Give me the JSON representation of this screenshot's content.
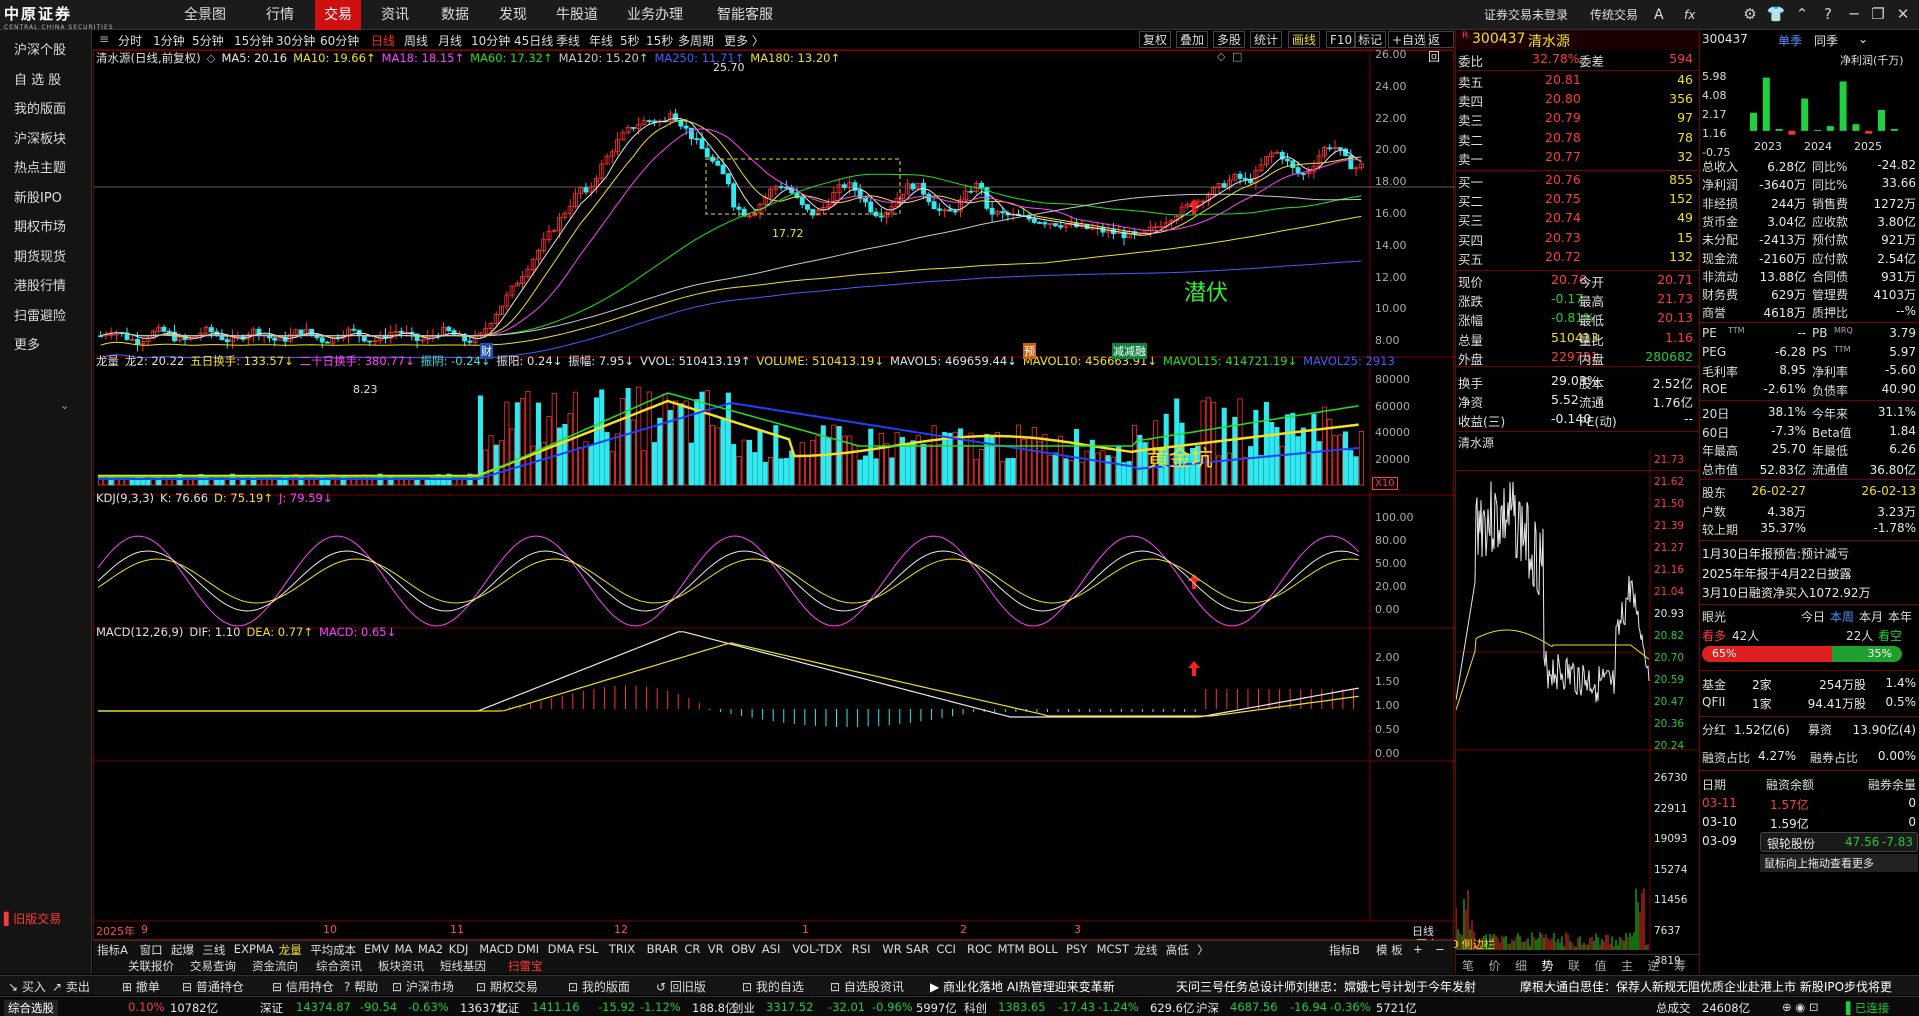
{
  "logo": {
    "text": "中原证券",
    "subtext": "CENTRAL CHINA SECURITIES"
  },
  "topnav": [
    "全景图",
    "行情",
    "交易",
    "资讯",
    "数据",
    "发现",
    "牛股道",
    "业务办理",
    "智能客服"
  ],
  "topright": {
    "login": "证券交易未登录",
    "mode": "传统交易",
    "font_icon": "A",
    "fx": "fx"
  },
  "sidebar": [
    "沪深个股",
    "自 选 股",
    "我的版面",
    "沪深板块",
    "热点主题",
    "新股IPO",
    "期权市场",
    "期货现货",
    "港股行情",
    "扫雷避险",
    "更多"
  ],
  "sidebar_bottom": "旧版交易",
  "toolbar_periods": [
    "分时",
    "1分钟",
    "5分钟",
    "15分钟",
    "30分钟",
    "60分钟",
    "日线",
    "周线",
    "月线",
    "10分钟",
    "45日线",
    "季线",
    "年线",
    "5秒",
    "15秒",
    "多周期",
    "更多"
  ],
  "toolbar_right": [
    "复权",
    "叠加",
    "多股",
    "统计",
    "画线",
    "F10",
    "标记",
    "+自选",
    "返回"
  ],
  "main_legend": {
    "name": "清水源(日线,前复权)",
    "ma5": "MA5: 20.16",
    "ma10": "MA10: 19.66",
    "ma18": "MA18: 18.15",
    "ma60": "MA60: 17.32",
    "ma120": "MA120: 15.20",
    "ma250": "MA250: 11.71",
    "ma180": "MA180: 13.20"
  },
  "price_axis": [
    "26.00",
    "24.00",
    "22.00",
    "20.00",
    "18.00",
    "16.00",
    "14.00",
    "12.00",
    "10.00",
    "8.00"
  ],
  "price_marks": {
    "high": "25.70",
    "low": "8.23",
    "box": "17.72"
  },
  "annotations": {
    "qianfu": "潜伏",
    "huangjinkeng": "黄金坑"
  },
  "event_markers": [
    "财",
    "预",
    "减减融"
  ],
  "vol_legend": {
    "name": "龙量",
    "l2": "龙2: 20.22",
    "wr5": "五日换手: 133.57",
    "wr20": "二十日换手: 380.77",
    "zy": "振阴: -0.24",
    "zyang": "振阳: 0.24",
    "zf": "振幅: 7.95",
    "vvol": "VVOL: 510413.19",
    "volume": "VOLUME: 510413.19",
    "mavol5": "MAVOL5: 469659.44",
    "mavol10": "MAVOL10: 456663.91",
    "mavol15": "MAVOL15: 414721.19",
    "mavol25": "MAVOL25: 2913"
  },
  "vol_axis": [
    "80000",
    "60000",
    "40000",
    "20000"
  ],
  "vol_unit": "X10",
  "kdj_legend": {
    "name": "KDJ(9,3,3)",
    "k": "K: 76.66",
    "d": "D: 75.19",
    "j": "J: 79.59"
  },
  "kdj_axis": [
    "100.00",
    "80.00",
    "50.00",
    "20.00",
    "0.00"
  ],
  "macd_legend": {
    "name": "MACD(12,26,9)",
    "dif": "DIF: 1.10",
    "dea": "DEA: 0.77",
    "macd": "MACD: 0.65"
  },
  "macd_axis": [
    "2.00",
    "1.50",
    "1.00",
    "0.50",
    "0.00"
  ],
  "time_axis": [
    "2025年",
    "9",
    "10",
    "11",
    "12",
    "1",
    "2",
    "3"
  ],
  "time_axis_right": "日线",
  "bottom_tabs": [
    "指标A",
    "窗口",
    "起爆",
    "三线",
    "EXPMA",
    "龙量",
    "平均成本",
    "EMV",
    "MA",
    "MA2",
    "KDJ",
    "MACD",
    "DMI",
    "DMA",
    "FSL",
    "TRIX",
    "BRAR",
    "CR",
    "VR",
    "OBV",
    "ASI",
    "VOL-TDX",
    "RSI",
    "WR",
    "SAR",
    "CCI",
    "ROC",
    "MTM",
    "BOLL",
    "PSY",
    "MCST",
    "龙线",
    "高低"
  ],
  "bottom_tabs_right": [
    "指标B",
    "模 板"
  ],
  "stock": {
    "code": "300437",
    "name": "清水源"
  },
  "orderbook": {
    "weibi_label": "委比",
    "weibi": "32.78%",
    "weicha_label": "委差",
    "weicha": "594",
    "sell": [
      [
        "卖五",
        "20.81",
        "46"
      ],
      [
        "卖四",
        "20.80",
        "356"
      ],
      [
        "卖三",
        "20.79",
        "97"
      ],
      [
        "卖二",
        "20.78",
        "78"
      ],
      [
        "卖一",
        "20.77",
        "32"
      ]
    ],
    "buy": [
      [
        "买一",
        "20.76",
        "855"
      ],
      [
        "买二",
        "20.75",
        "152"
      ],
      [
        "买三",
        "20.74",
        "49"
      ],
      [
        "买四",
        "20.73",
        "15"
      ],
      [
        "买五",
        "20.72",
        "132"
      ]
    ]
  },
  "quote": [
    [
      "现价",
      "20.76",
      "今开",
      "20.71"
    ],
    [
      "涨跌",
      "-0.17",
      "最高",
      "21.73"
    ],
    [
      "涨幅",
      "-0.81%",
      "最低",
      "20.13"
    ],
    [
      "总量",
      "510413",
      "量比",
      "1.16"
    ],
    [
      "外盘",
      "229731",
      "内盘",
      "280682"
    ],
    [
      "换手",
      "29.03%",
      "股本",
      "2.52亿"
    ],
    [
      "净资",
      "5.52",
      "流通",
      "1.76亿"
    ],
    [
      "收益(三)",
      "-0.140",
      "PE(动)",
      "--"
    ]
  ],
  "mini_title": "清水源",
  "mini_axis": [
    "21.73",
    "21.62",
    "21.50",
    "21.39",
    "21.27",
    "21.16",
    "21.04",
    "20.93",
    "20.82",
    "20.70",
    "20.59",
    "20.47",
    "20.36",
    "20.24"
  ],
  "mini_vol_axis": [
    "26730",
    "22911",
    "19093",
    "15274",
    "11456",
    "7637",
    "3819"
  ],
  "fr": {
    "code": "300437",
    "tabs": [
      "单季",
      "同季",
      "净利润(千万)"
    ],
    "chart_y": [
      "5.98",
      "4.08",
      "2.17",
      "1.16",
      "-0.75"
    ],
    "chart_x": [
      "2023",
      "2024",
      "2025"
    ],
    "chart_data": {
      "type": "bar",
      "categories": [
        "2023Q1",
        "2023Q2",
        "2023Q3",
        "2023Q4",
        "2024Q1",
        "2024Q2",
        "2024Q3",
        "2024Q4",
        "2025Q1",
        "2025Q2",
        "2025Q3",
        "2025Q4"
      ],
      "values": [
        1.9,
        5.6,
        0.2,
        -0.4,
        3.4,
        0.1,
        0.5,
        5.2,
        0.7,
        -0.3,
        2.2,
        0.2
      ],
      "ylim": [
        -0.75,
        5.98
      ]
    },
    "fin": [
      [
        "总收入",
        "6.28亿",
        "同比%",
        "-24.82"
      ],
      [
        "净利润",
        "-3640万",
        "同比%",
        "33.66"
      ],
      [
        "非经损",
        "244万",
        "销售费",
        "1272万"
      ],
      [
        "货币金",
        "3.04亿",
        "应收款",
        "3.80亿"
      ],
      [
        "未分配",
        "-2413万",
        "预付款",
        "921万"
      ],
      [
        "现金流",
        "-2160万",
        "应付款",
        "2.54亿"
      ],
      [
        "非流动",
        "13.88亿",
        "合同债",
        "931万"
      ],
      [
        "财务费",
        "629万",
        "管理费",
        "4103万"
      ],
      [
        "商誉",
        "4618万",
        "质押比",
        "--%"
      ]
    ],
    "val": [
      [
        "PE",
        "TTM",
        "--",
        "PB",
        "MRQ",
        "3.79"
      ],
      [
        "PEG",
        "",
        "-6.28",
        "PS",
        "TTM",
        "5.97"
      ],
      [
        "毛利率",
        "",
        "8.95",
        "净利率",
        "",
        "-5.60"
      ],
      [
        "ROE",
        "",
        "-2.61%",
        "负债率",
        "",
        "40.90"
      ]
    ],
    "perf": [
      [
        "20日",
        "38.1%",
        "今年来",
        "31.1%"
      ],
      [
        "60日",
        "-7.3%",
        "Beta值",
        "1.84"
      ],
      [
        "年最高",
        "25.70",
        "年最低",
        "6.26"
      ],
      [
        "总市值",
        "52.83亿",
        "流通值",
        "36.80亿"
      ]
    ],
    "holder": [
      [
        "股东",
        "26-02-27",
        "26-02-13"
      ],
      [
        "户数",
        "4.38万",
        "3.23万"
      ],
      [
        "较上期",
        "35.37%",
        "-1.78%"
      ]
    ],
    "news": [
      "1月30日年报预告:预计减亏",
      "2025年年报于4月22日披露",
      "3月10日融资净买入1072.92万"
    ],
    "eye": {
      "label": "眼光",
      "tabs": [
        "今日",
        "本周",
        "本月",
        "本年"
      ],
      "bull_label": "看多",
      "bull": "42人",
      "bear": "22人",
      "bear_label": "看空",
      "bull_pct": "65%",
      "bear_pct": "35%"
    },
    "inst": [
      [
        "基金",
        "2家",
        "254万股",
        "1.4%"
      ],
      [
        "QFII",
        "1家",
        "94.41万股",
        "0.5%"
      ]
    ],
    "div": {
      "label": "分红",
      "v1": "1.52亿(6)",
      "l2": "募资",
      "v2": "13.90亿(4)"
    },
    "margin_ratio": {
      "l1": "融资占比",
      "v1": "4.27%",
      "l2": "融券占比",
      "v2": "0.00%"
    },
    "margin_head": [
      "日期",
      "融资余额",
      "融券余量"
    ],
    "margin": [
      [
        "03-11",
        "1.57亿",
        "0"
      ],
      [
        "03-10",
        "1.59亿",
        "0"
      ],
      [
        "03-09",
        "",
        ""
      ]
    ],
    "ticker_stock": {
      "name": "银轮股份",
      "price": "47.56",
      "chg": "-7.83"
    }
  },
  "right_bottom_tabs": [
    "笔",
    "价",
    "细",
    "势",
    "联",
    "值",
    "主",
    "逆",
    "筹"
  ],
  "chart_footer": [
    "图文F10",
    "侧边栏"
  ],
  "funcbar": [
    "买入",
    "卖出",
    "撤单",
    "普通持仓",
    "信用持仓",
    "帮助",
    "沪深市场",
    "期权交易",
    "我的版面",
    "回旧版",
    "我的自选",
    "自选股资讯"
  ],
  "funcbar_news": [
    "商业化落地 AI热管理迎来变革新",
    "天问三号任务总设计师刘继忠：嫦娥七号计划于今年发射",
    "摩根大通白思佳：保荐人新规无阻优质企业赴港上市 新股IPO步伐将更"
  ],
  "ticker": {
    "left": "综合选股",
    "items": [
      [
        "",
        "0.10%",
        "10782亿"
      ],
      [
        "深证",
        "14374.87",
        "-90.54",
        "-0.63%",
        "13637亿"
      ],
      [
        "北证",
        "1411.16",
        "-15.92",
        "-1.12%",
        "188.8亿"
      ],
      [
        "创业",
        "3317.52",
        "-32.01",
        "-0.96%",
        "5997亿"
      ],
      [
        "科创",
        "1383.65",
        "-17.43",
        "-1.24%",
        "629.6亿"
      ],
      [
        "沪深",
        "4687.56",
        "-16.94",
        "-0.36%",
        "5721亿"
      ]
    ],
    "total_label": "总成交",
    "total": "24608亿",
    "status": "已连接"
  },
  "funcbar_extra": [
    "关联报价",
    "交易查询",
    "资金流向",
    "综合资讯",
    "板块资讯",
    "短线基因",
    "扫雷宝"
  ],
  "tooltip": "鼠标向上拖动查看更多"
}
